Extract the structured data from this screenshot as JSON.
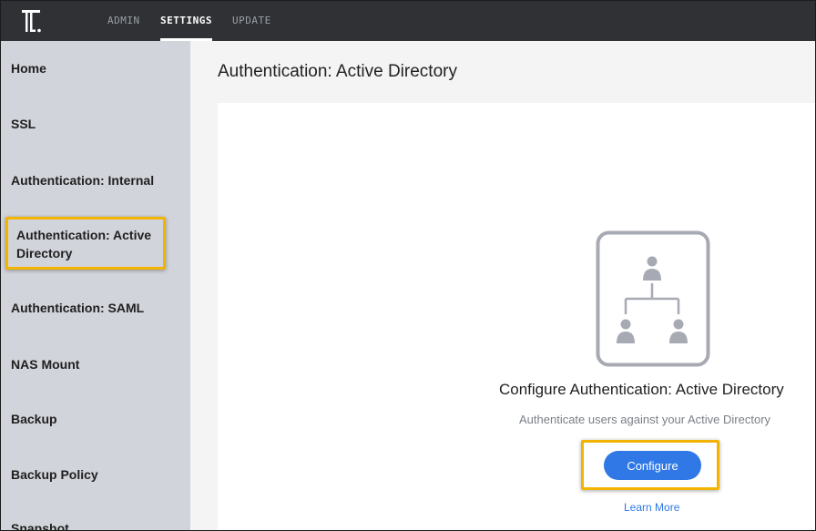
{
  "topbar": {
    "logo_icon": "t-logo-icon",
    "tabs": [
      {
        "label": "ADMIN",
        "active": false
      },
      {
        "label": "SETTINGS",
        "active": true
      },
      {
        "label": "UPDATE",
        "active": false
      }
    ]
  },
  "sidebar": {
    "items": [
      {
        "label": "Home"
      },
      {
        "label": "SSL"
      },
      {
        "label": "Authentication: Internal"
      },
      {
        "label": "Authentication: Active Directory",
        "active": true
      },
      {
        "label": "Authentication: SAML"
      },
      {
        "label": "NAS Mount"
      },
      {
        "label": "Backup"
      },
      {
        "label": "Backup Policy"
      },
      {
        "label": "Snapshot"
      }
    ]
  },
  "main": {
    "title": "Authentication: Active Directory",
    "illustration_icon": "org-hierarchy-icon",
    "configure_title": "Configure Authentication: Active Directory",
    "configure_subtitle": "Authenticate users against your Active Directory",
    "configure_button": "Configure",
    "learn_more": "Learn More"
  },
  "colors": {
    "topbar": "#2f3134",
    "sidebar": "#d2d4db",
    "accent": "#2f78e6",
    "highlight": "#f2b400"
  }
}
